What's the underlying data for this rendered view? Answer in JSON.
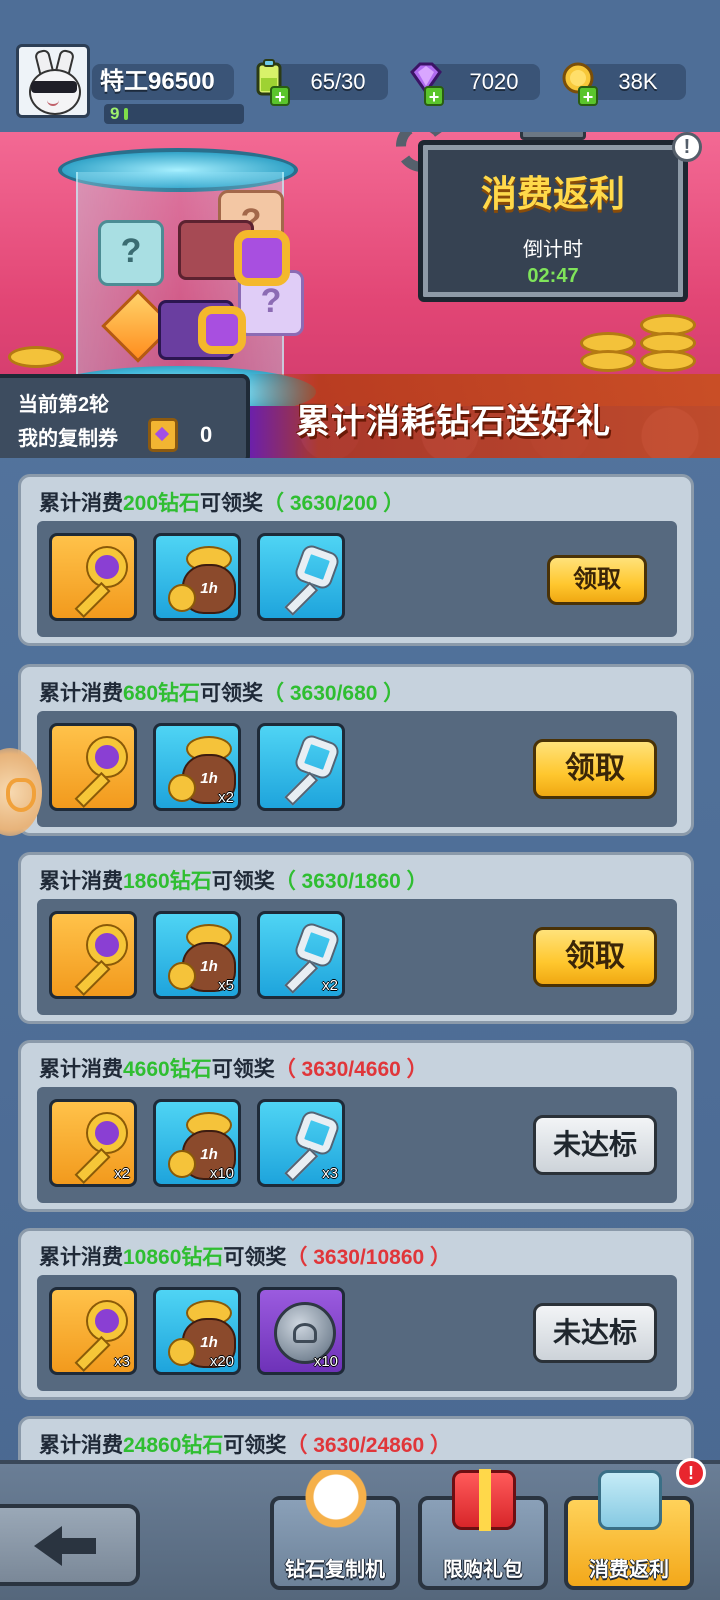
{
  "player": {
    "name": "特工96500",
    "level": "9",
    "level_progress": 0.03
  },
  "resources": {
    "energy": "65/30",
    "gems": "7020",
    "gold": "38K"
  },
  "event": {
    "title": "消费返利",
    "countdown_label": "倒计时",
    "countdown": "02:47",
    "slogan": "累计消耗钻石送好礼",
    "round": "当前第2轮",
    "coupon_label": "我的复制券",
    "coupon_count": "0"
  },
  "tiers": [
    {
      "prefix": "累计消费",
      "amount": "200钻石",
      "suffix": "可领奖",
      "progress": "（ 3630/200 ）",
      "reached": true,
      "rewards": [
        {
          "icon": "gold-key-icon",
          "count": ""
        },
        {
          "icon": "coin-bag-icon",
          "label": "1h",
          "count": ""
        },
        {
          "icon": "silver-key-icon",
          "count": ""
        }
      ],
      "button": "领取"
    },
    {
      "prefix": "累计消费",
      "amount": "680钻石",
      "suffix": "可领奖",
      "progress": "（ 3630/680 ）",
      "reached": true,
      "rewards": [
        {
          "icon": "gold-key-icon",
          "count": ""
        },
        {
          "icon": "coin-bag-icon",
          "label": "1h",
          "count": "x2"
        },
        {
          "icon": "silver-key-icon",
          "count": ""
        }
      ],
      "button": "领取"
    },
    {
      "prefix": "累计消费",
      "amount": "1860钻石",
      "suffix": "可领奖",
      "progress": "（ 3630/1860 ）",
      "reached": true,
      "rewards": [
        {
          "icon": "gold-key-icon",
          "count": ""
        },
        {
          "icon": "coin-bag-icon",
          "label": "1h",
          "count": "x5"
        },
        {
          "icon": "silver-key-icon",
          "count": "x2"
        }
      ],
      "button": "领取"
    },
    {
      "prefix": "累计消费",
      "amount": "4660钻石",
      "suffix": "可领奖",
      "progress": "（ 3630/4660 ）",
      "reached": false,
      "rewards": [
        {
          "icon": "gold-key-icon",
          "count": "x2"
        },
        {
          "icon": "coin-bag-icon",
          "label": "1h",
          "count": "x10"
        },
        {
          "icon": "silver-key-icon",
          "count": "x3"
        }
      ],
      "button": "未达标"
    },
    {
      "prefix": "累计消费",
      "amount": "10860钻石",
      "suffix": "可领奖",
      "progress": "（ 3630/10860 ）",
      "reached": false,
      "rewards": [
        {
          "icon": "gold-key-icon",
          "count": "x3"
        },
        {
          "icon": "coin-bag-icon",
          "label": "1h",
          "count": "x20"
        },
        {
          "icon": "silver-medal-icon",
          "count": "x10"
        }
      ],
      "button": "未达标"
    },
    {
      "prefix": "累计消费",
      "amount": "24860钻石",
      "suffix": "可领奖",
      "progress": "（ 3630/24860 ）",
      "reached": false
    }
  ],
  "nav": {
    "diamond_copier": "钻石复制机",
    "limited_pack": "限购礼包",
    "spend_rebate": "消费返利",
    "alert": "!"
  },
  "colors": {
    "reached": "#2fbe31",
    "not_reached": "#e0363a",
    "accent_gold": "#ffd94a"
  }
}
